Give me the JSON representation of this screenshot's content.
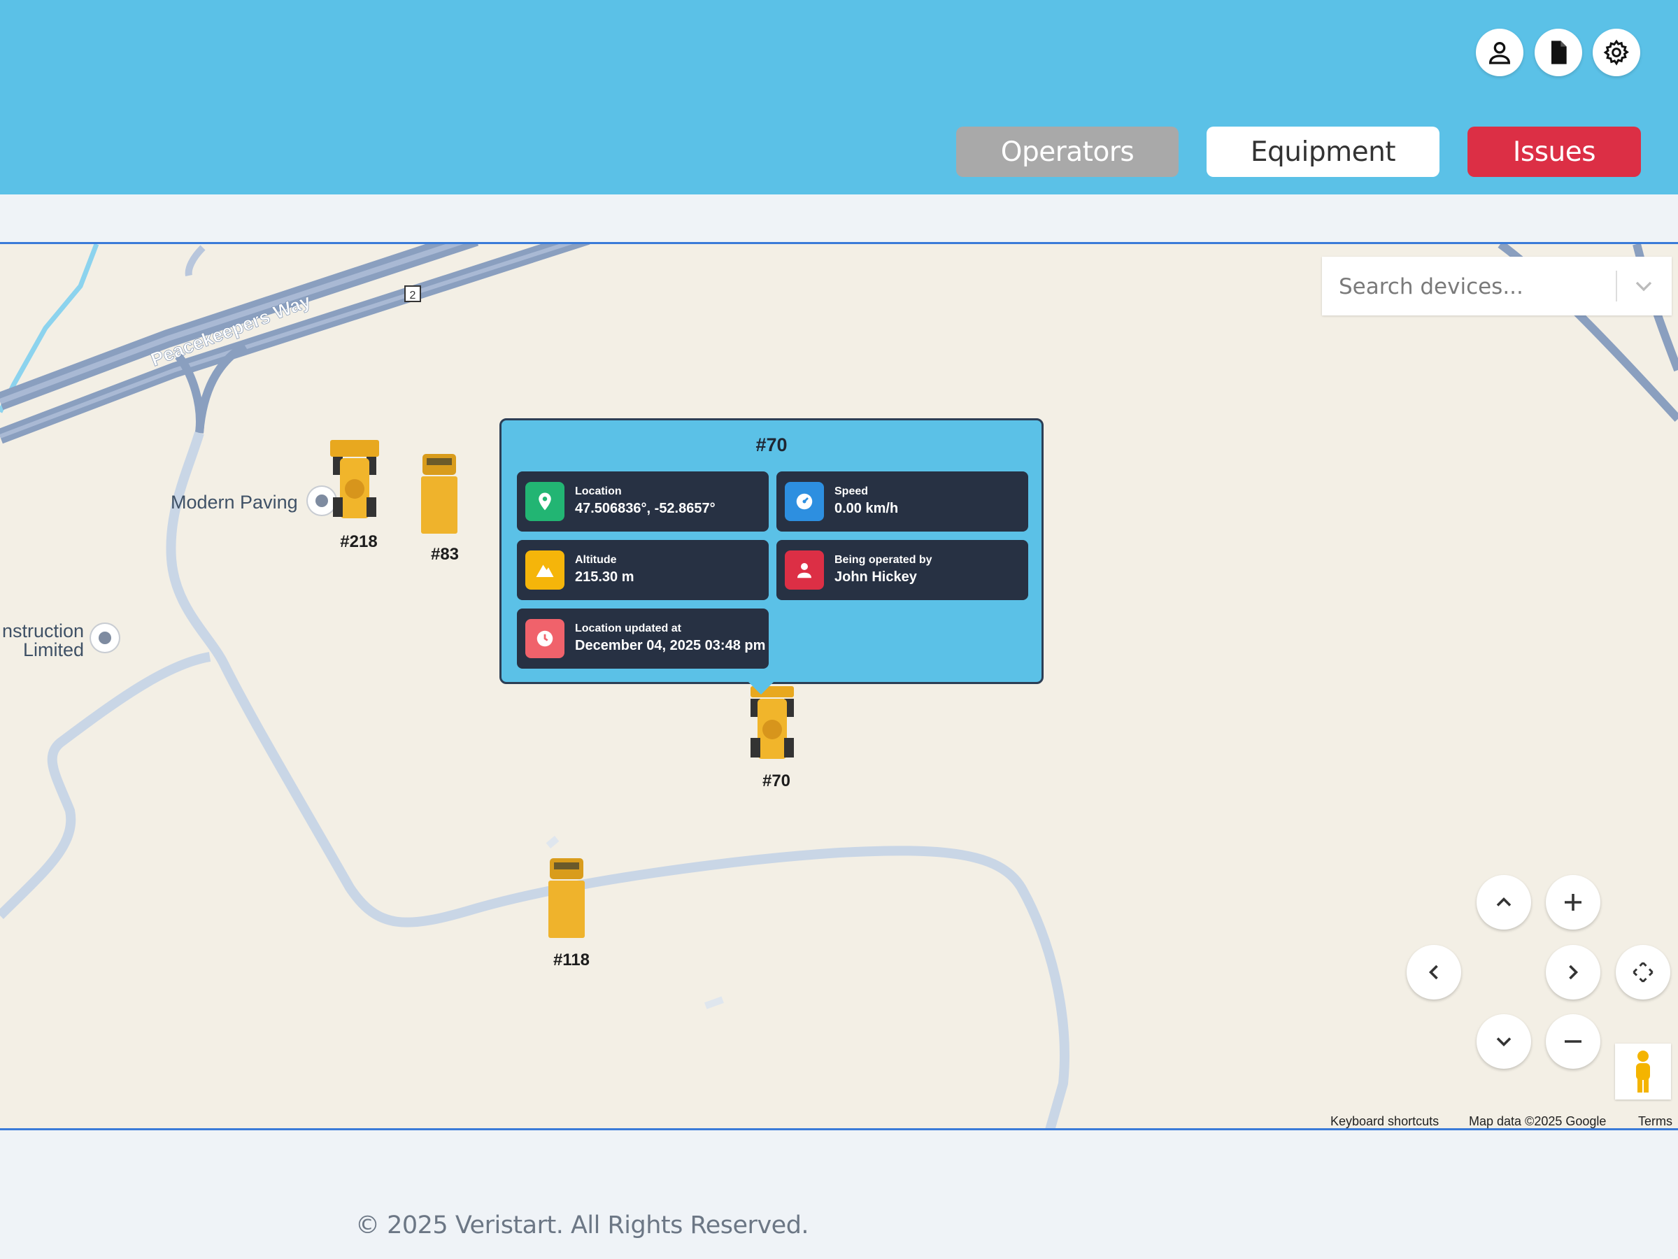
{
  "header": {
    "icons": [
      "user-icon",
      "document-icon",
      "gear-icon"
    ],
    "nav": {
      "operators": "Operators",
      "equipment": "Equipment",
      "issues": "Issues"
    },
    "colors": {
      "header_bg": "#5bc1e7",
      "operators_bg": "#a9a9a9",
      "issues_bg": "#dc2f45"
    }
  },
  "map": {
    "search_placeholder": "Search devices...",
    "road_label": "Peacekeepers Way",
    "road_shield": "2",
    "places": [
      {
        "name": "Modern Paving"
      },
      {
        "name_line1": "nstruction",
        "name_line2": "Limited"
      }
    ],
    "vehicles": [
      {
        "label": "#218",
        "kind": "loader"
      },
      {
        "label": "#83",
        "kind": "truck"
      },
      {
        "label": "#70",
        "kind": "loader"
      },
      {
        "label": "#118",
        "kind": "truck"
      }
    ],
    "popup": {
      "title": "#70",
      "location_label": "Location",
      "location_value": "47.506836°, -52.8657°",
      "speed_label": "Speed",
      "speed_value": "0.00 km/h",
      "altitude_label": "Altitude",
      "altitude_value": "215.30 m",
      "operator_label": "Being operated by",
      "operator_value": "John Hickey",
      "updated_label": "Location updated at",
      "updated_value": "December 04, 2025 03:48 pm"
    },
    "attribution": {
      "shortcuts": "Keyboard shortcuts",
      "data": "Map data ©2025 Google",
      "terms": "Terms"
    }
  },
  "footer": {
    "copyright": "© 2025 Veristart. All Rights Reserved."
  }
}
